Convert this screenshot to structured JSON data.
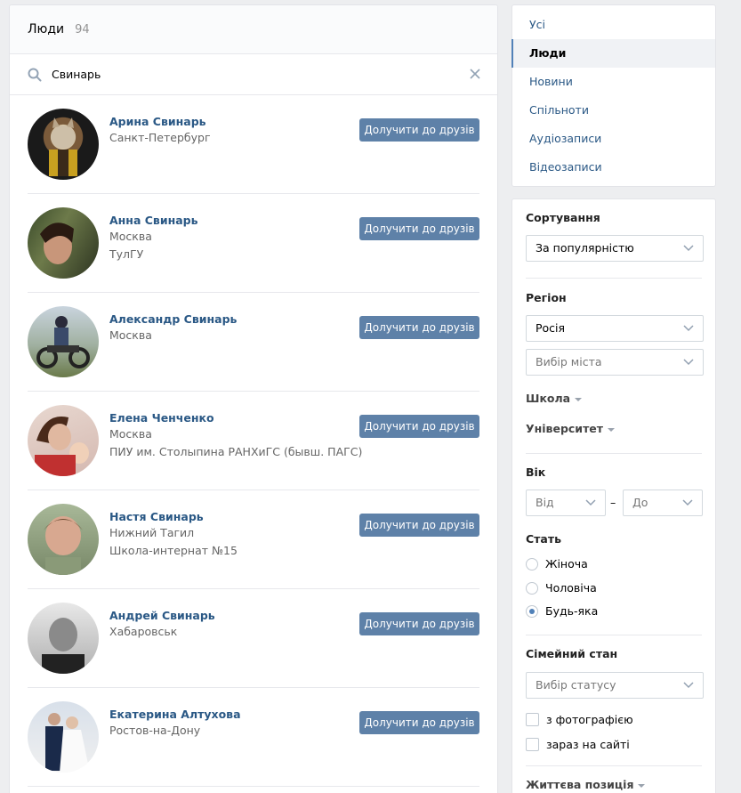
{
  "header": {
    "title": "Люди",
    "count": "94"
  },
  "search": {
    "value": "Свинарь"
  },
  "add_label": "Долучити до друзів",
  "people": [
    {
      "name": "Арина Свинарь",
      "lines": [
        "Санкт-Петербург"
      ]
    },
    {
      "name": "Анна Свинарь",
      "lines": [
        "Москва",
        "ТулГУ"
      ]
    },
    {
      "name": "Александр Свинарь",
      "lines": [
        "Москва"
      ]
    },
    {
      "name": "Елена Ченченко",
      "lines": [
        "Москва",
        "ПИУ им. Столыпина РАНХиГС (бывш. ПАГС)"
      ]
    },
    {
      "name": "Настя Свинарь",
      "lines": [
        "Нижний Тагил",
        "Школа-интернат №15"
      ]
    },
    {
      "name": "Андрей Свинарь",
      "lines": [
        "Хабаровськ"
      ]
    },
    {
      "name": "Екатерина Алтухова",
      "lines": [
        "Ростов-на-Дону"
      ]
    }
  ],
  "nav": {
    "items": [
      "Усі",
      "Люди",
      "Новини",
      "Спільноти",
      "Аудіозаписи",
      "Відеозаписи"
    ],
    "active": "Люди"
  },
  "filters": {
    "sort_label": "Сортування",
    "sort_value": "За популярністю",
    "region_label": "Регіон",
    "country_value": "Росія",
    "city_placeholder": "Вибір міста",
    "school_label": "Школа",
    "university_label": "Університет",
    "age_label": "Вік",
    "age_from": "Від",
    "age_dash": "–",
    "age_to": "До",
    "gender_label": "Стать",
    "gender_options": [
      "Жіноча",
      "Чоловіча",
      "Будь-яка"
    ],
    "gender_selected": "Будь-яка",
    "marital_label": "Сімейний стан",
    "marital_placeholder": "Вибір статусу",
    "with_photo": "з фотографією",
    "online_now": "зараз на сайті",
    "life_position_label": "Життєва позиція"
  },
  "colors": {
    "link": "#2a5885",
    "button": "#5e81a8",
    "accent": "#5181b8"
  }
}
